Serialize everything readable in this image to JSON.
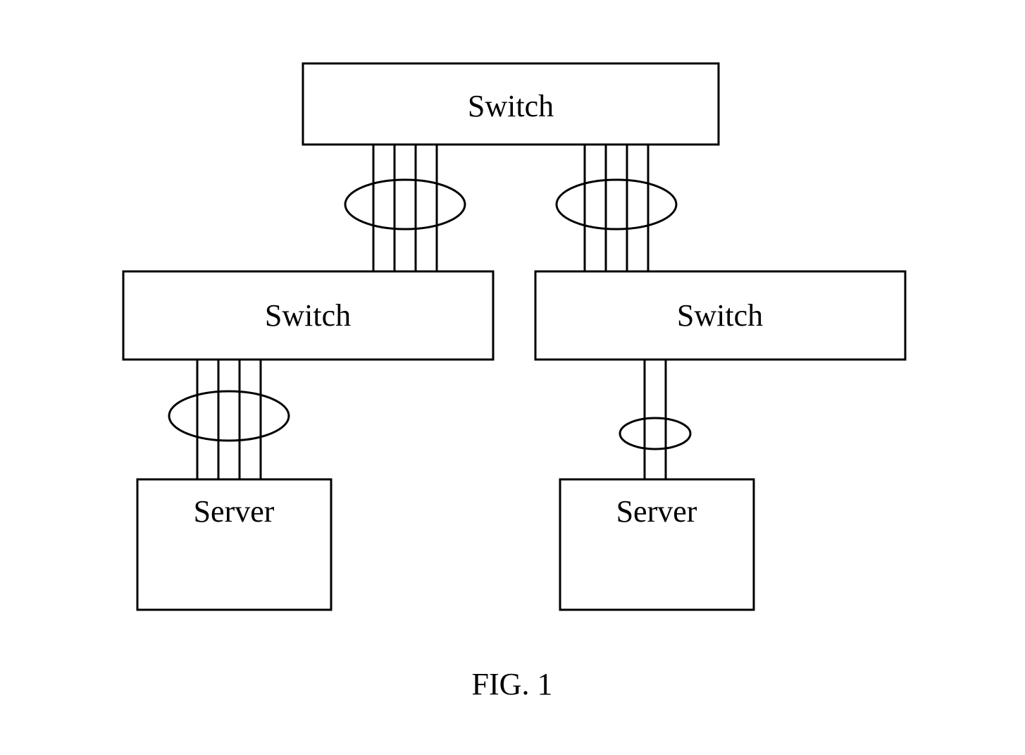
{
  "diagram": {
    "nodes": {
      "top_switch": {
        "label": "Switch"
      },
      "left_switch": {
        "label": "Switch"
      },
      "right_switch": {
        "label": "Switch"
      },
      "left_server": {
        "label": "Server"
      },
      "right_server": {
        "label": "Server"
      }
    },
    "caption": "FIG. 1",
    "links": {
      "top_to_left": {
        "count": 4
      },
      "top_to_right": {
        "count": 4
      },
      "left_to_server": {
        "count": 4
      },
      "right_to_server": {
        "count": 2
      }
    }
  }
}
